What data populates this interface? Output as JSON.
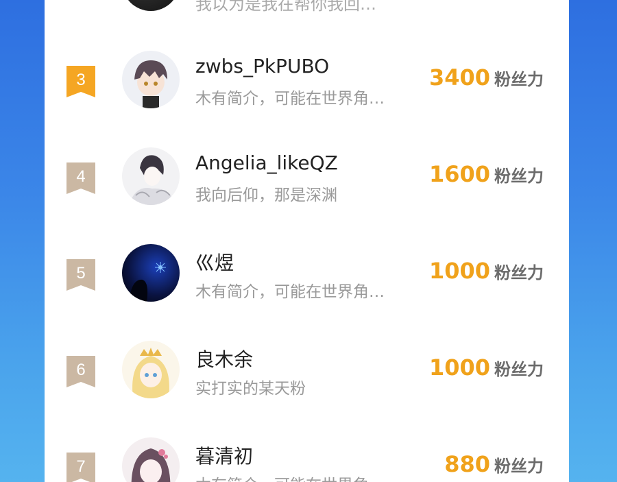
{
  "top_partial": {
    "bio": "我以为是我在帮你我回…"
  },
  "colors": {
    "rank_gold": "#f5a623",
    "rank_tan": "#cbb8a3",
    "score": "#f0a21b"
  },
  "list": [
    {
      "rank": "3",
      "name": "zwbs_PkPUBO",
      "bio": "木有简介，可能在世界角…",
      "score": "3400",
      "unit": "粉丝力"
    },
    {
      "rank": "4",
      "name": "Angelia_likeQZ",
      "bio": "我向后仰，那是深渊",
      "score": "1600",
      "unit": "粉丝力"
    },
    {
      "rank": "5",
      "name": "巛煜",
      "bio": "木有简介，可能在世界角…",
      "score": "1000",
      "unit": "粉丝力"
    },
    {
      "rank": "6",
      "name": "良木余",
      "bio": "实打实的某天粉",
      "score": "1000",
      "unit": "粉丝力"
    },
    {
      "rank": "7",
      "name": "暮清初",
      "bio": "木有简介，可能在世界角…",
      "score": "880",
      "unit": "粉丝力"
    }
  ]
}
